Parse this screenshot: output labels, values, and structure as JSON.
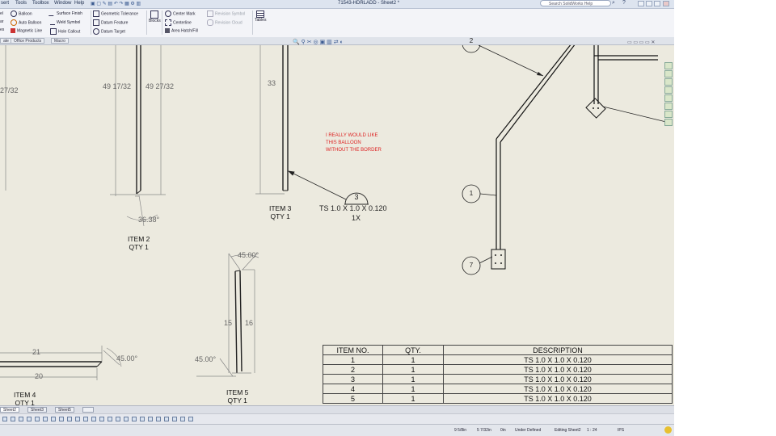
{
  "app": {
    "window_title": "71543-HDRLADD - Sheet2 *",
    "help_search_placeholder": "Search SolidWorks Help",
    "menu": [
      "sert",
      "Tools",
      "Toolbox",
      "Window",
      "Help"
    ]
  },
  "ribbon": {
    "col1": [
      "Balloon",
      "Auto Balloon",
      "Magnetic Line"
    ],
    "col2": [
      "Surface Finish",
      "Weld Symbol",
      "Hole Callout"
    ],
    "col3": [
      "Geometric Tolerance",
      "Datum Feature",
      "Datum Target"
    ],
    "blocks": "Blocks",
    "col4": [
      "Center Mark",
      "Centerline",
      "Area Hatch/Fill"
    ],
    "col5": [
      "Revision Symbol",
      "Revision Cloud"
    ],
    "tables": "Tables",
    "left_fragments": [
      "el",
      "ar",
      "es"
    ]
  },
  "cm_tabs": [
    "ate",
    "Office Products",
    "Macro"
  ],
  "drawing": {
    "dims": {
      "d_27_32": "27/32",
      "d_49_17_32": "49 17/32",
      "d_49_27_32": "49 27/32",
      "d_33": "33",
      "d_36_38": "36.38°",
      "d_45_top": "45.00°",
      "d_15": "15",
      "d_16": "16",
      "d_45_left": "45.00°",
      "d_21": "21",
      "d_20": "20",
      "d_45_mid": "45.00°"
    },
    "items": {
      "item2": [
        "ITEM 2",
        "QTY 1"
      ],
      "item3": [
        "ITEM 3",
        "QTY 1"
      ],
      "item4": [
        "ITEM 4",
        "QTY 1"
      ],
      "item5": [
        "ITEM 5",
        "QTY 1"
      ]
    },
    "note": [
      "I REALLY WOULD LIKE",
      "THIS BALLOON",
      "WITHOUT THE BORDER"
    ],
    "balloon_item3": {
      "number": "3",
      "description": "TS 1.0 X 1.0 X 0.120",
      "qty": "1X"
    },
    "balloons": {
      "b1": "1",
      "b2": "2",
      "b7": "7"
    }
  },
  "bom": {
    "headers": [
      "ITEM NO.",
      "QTY.",
      "DESCRIPTION"
    ],
    "rows": [
      [
        "1",
        "1",
        "TS 1.0 X 1.0 X 0.120"
      ],
      [
        "2",
        "1",
        "TS 1.0 X 1.0 X 0.120"
      ],
      [
        "3",
        "1",
        "TS 1.0 X 1.0 X 0.120"
      ],
      [
        "4",
        "1",
        "TS 1.0 X 1.0 X 0.120"
      ],
      [
        "5",
        "1",
        "TS 1.0 X 1.0 X 0.120"
      ]
    ]
  },
  "sheet_tabs": [
    "Sheet2",
    "Sheet3",
    "Sheet5"
  ],
  "status": {
    "x": "9 5/8in",
    "y": "5 7/32in",
    "z": "0in",
    "state": "Under Defined",
    "editing": "Editing Sheet2",
    "scale": "1 : 24",
    "units": "IPS"
  },
  "colors": {
    "sheet_bg": "#eceadf",
    "note_red": "#dd2222",
    "ribbon_bg": "#f3f4f8"
  }
}
